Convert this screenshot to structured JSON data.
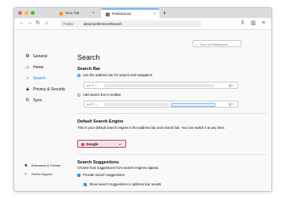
{
  "window_controls": {
    "close_color": "#ff5f57",
    "minimize_color": "#febc2e",
    "maximize_color": "#28c840"
  },
  "tabs": [
    {
      "label": "New Tab",
      "icon": "firefox-icon",
      "active": false
    },
    {
      "label": "Preferences",
      "icon": "gear-icon",
      "active": true
    }
  ],
  "new_tab_label": "+",
  "nav": {
    "back": "←",
    "forward": "→",
    "reload": "↻",
    "home": "⌂",
    "menu": "≡",
    "sidebar": "▥",
    "library": "⫴"
  },
  "urlbar": {
    "identity": "Firefox",
    "url": "about:preferences#search"
  },
  "find": {
    "placeholder": "Find in Preferences"
  },
  "sidebar": {
    "items": [
      {
        "label": "General",
        "icon": "gear-icon",
        "active": false
      },
      {
        "label": "Home",
        "icon": "home-icon",
        "active": false
      },
      {
        "label": "Search",
        "icon": "search-icon",
        "active": true
      },
      {
        "label": "Privacy & Security",
        "icon": "lock-icon",
        "active": false
      },
      {
        "label": "Sync",
        "icon": "sync-icon",
        "active": false
      }
    ],
    "bottom": [
      {
        "label": "Extensions & Themes",
        "icon": "puzzle-icon"
      },
      {
        "label": "Firefox Support",
        "icon": "help-icon"
      }
    ]
  },
  "main": {
    "title": "Search",
    "search_bar": {
      "heading": "Search Bar",
      "option_address": "Use the address bar for search and navigation",
      "option_toolbar": "Add search bar in toolbar"
    },
    "default_engine": {
      "heading": "Default Search Engine",
      "description": "This is your default search engine in the address bar and search bar. You can switch it at any time.",
      "selected": "Google"
    },
    "suggestions": {
      "heading": "Search Suggestions",
      "description": "Choose how suggestions from search engines appear.",
      "provide": "Provide search suggestions",
      "show_in_address": "Show search suggestions in address bar results"
    }
  },
  "colors": {
    "accent": "#0a84ff",
    "highlight_border": "#e22850"
  }
}
